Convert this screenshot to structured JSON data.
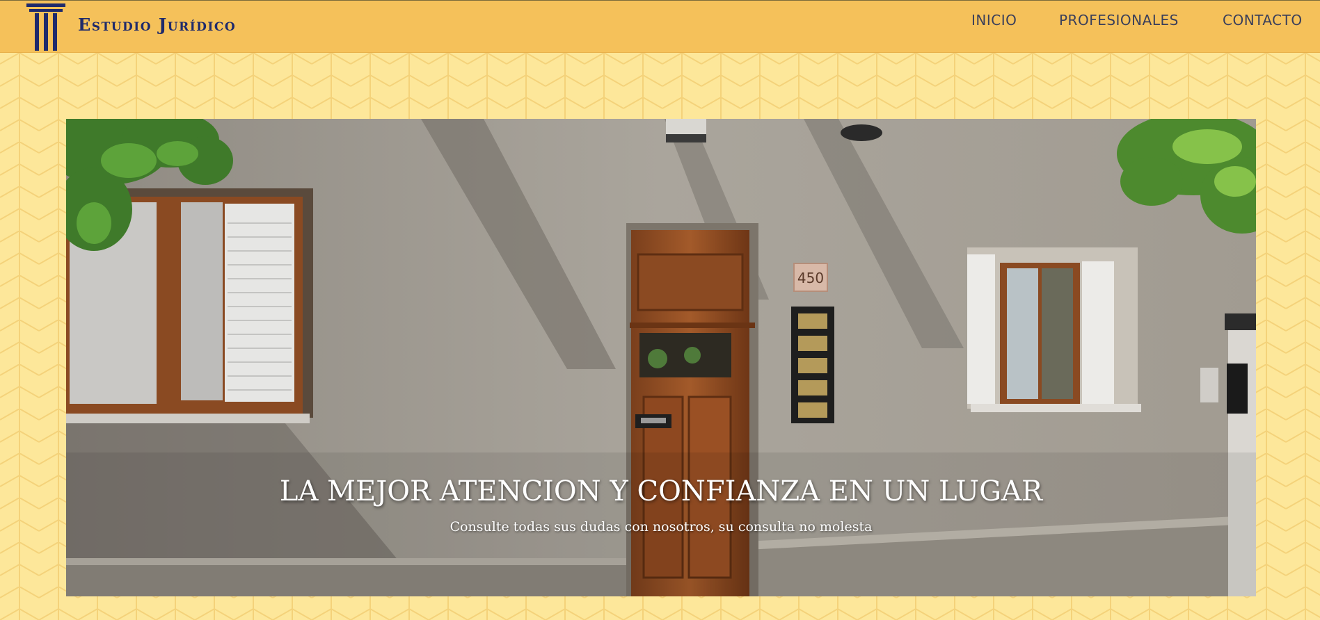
{
  "brand": {
    "name": "Estudio Jurídico",
    "logo_icon": "column-pillar-icon",
    "color": "#1f2a6b"
  },
  "nav": {
    "items": [
      {
        "label": "INICIO"
      },
      {
        "label": "PROFESIONALES"
      },
      {
        "label": "CONTACTO"
      }
    ]
  },
  "hero": {
    "title": "LA MEJOR ATENCION Y CONFIANZA EN UN LUGAR",
    "subtitle": "Consulte todas sus dudas con nosotros, su consulta no molesta",
    "door_number": "450"
  },
  "colors": {
    "header_bg": "#f5c15a",
    "page_bg": "#fde79a",
    "accent": "#1f2a6b"
  }
}
